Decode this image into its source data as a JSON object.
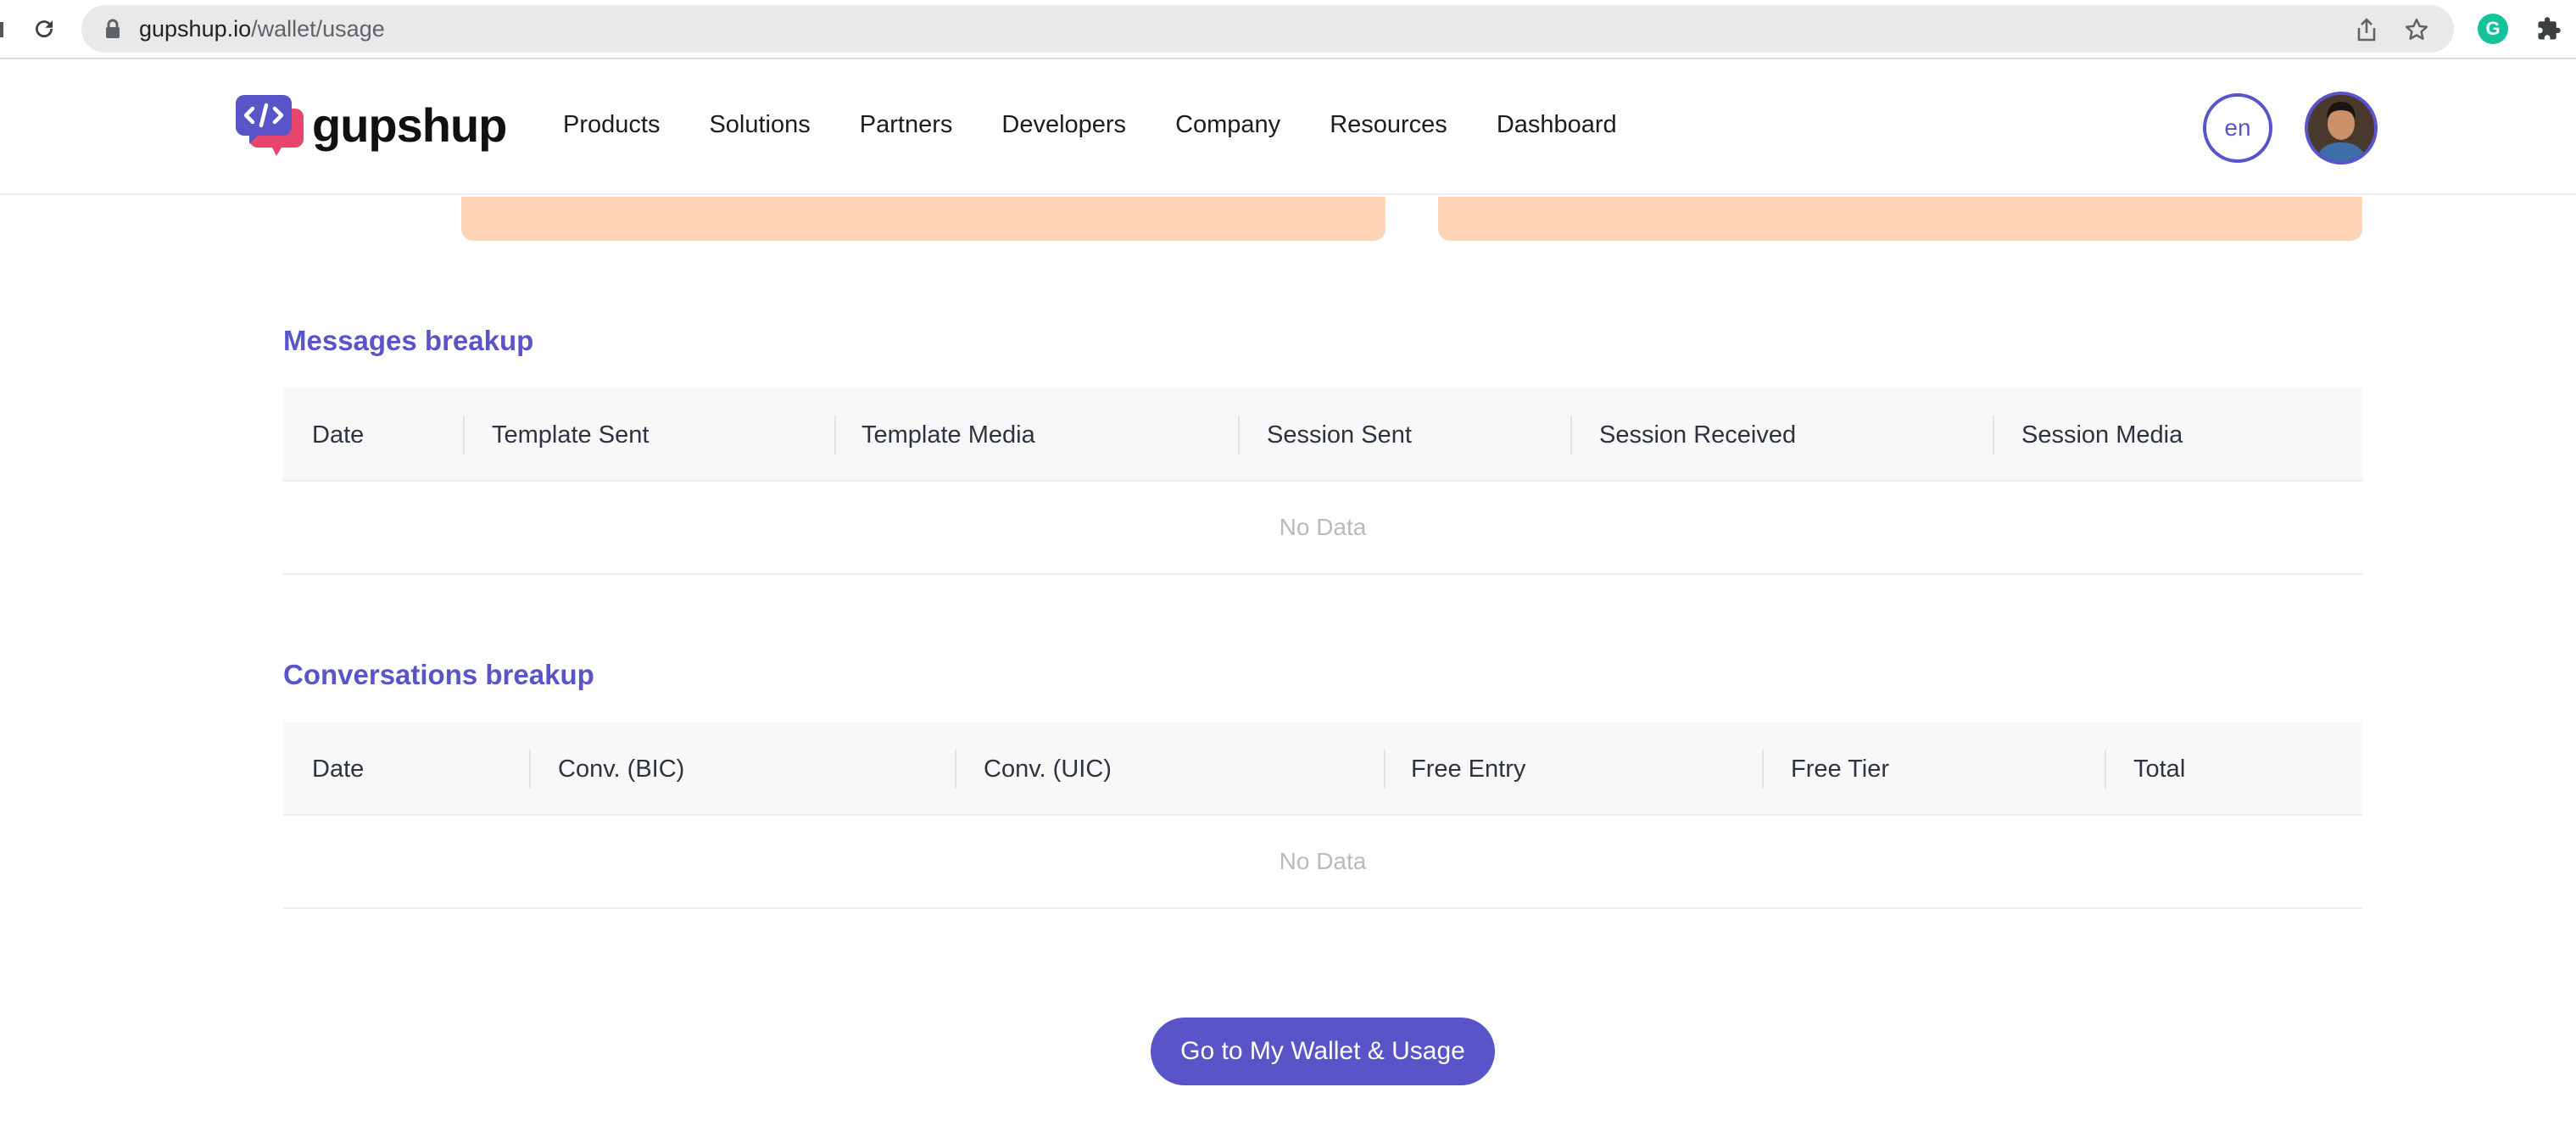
{
  "browser": {
    "url_host": "gupshup.io",
    "url_path": "/wallet/usage",
    "extension_badge": "G"
  },
  "header": {
    "logo_text": "gupshup",
    "nav": [
      "Products",
      "Solutions",
      "Partners",
      "Developers",
      "Company",
      "Resources",
      "Dashboard"
    ],
    "language": "en"
  },
  "messages_breakup": {
    "title": "Messages breakup",
    "columns": [
      "Date",
      "Template Sent",
      "Template Media",
      "Session Sent",
      "Session Received",
      "Session Media"
    ],
    "empty_text": "No Data"
  },
  "conversations_breakup": {
    "title": "Conversations breakup",
    "columns": [
      "Date",
      "Conv. (BIC)",
      "Conv. (UIC)",
      "Free Entry",
      "Free Tier",
      "Total"
    ],
    "empty_text": "No Data"
  },
  "cta": {
    "label": "Go to My Wallet & Usage"
  },
  "colors": {
    "accent": "#5a54c9",
    "card_peach": "#ffd3b5",
    "table_header_bg": "#f8f8f9"
  }
}
